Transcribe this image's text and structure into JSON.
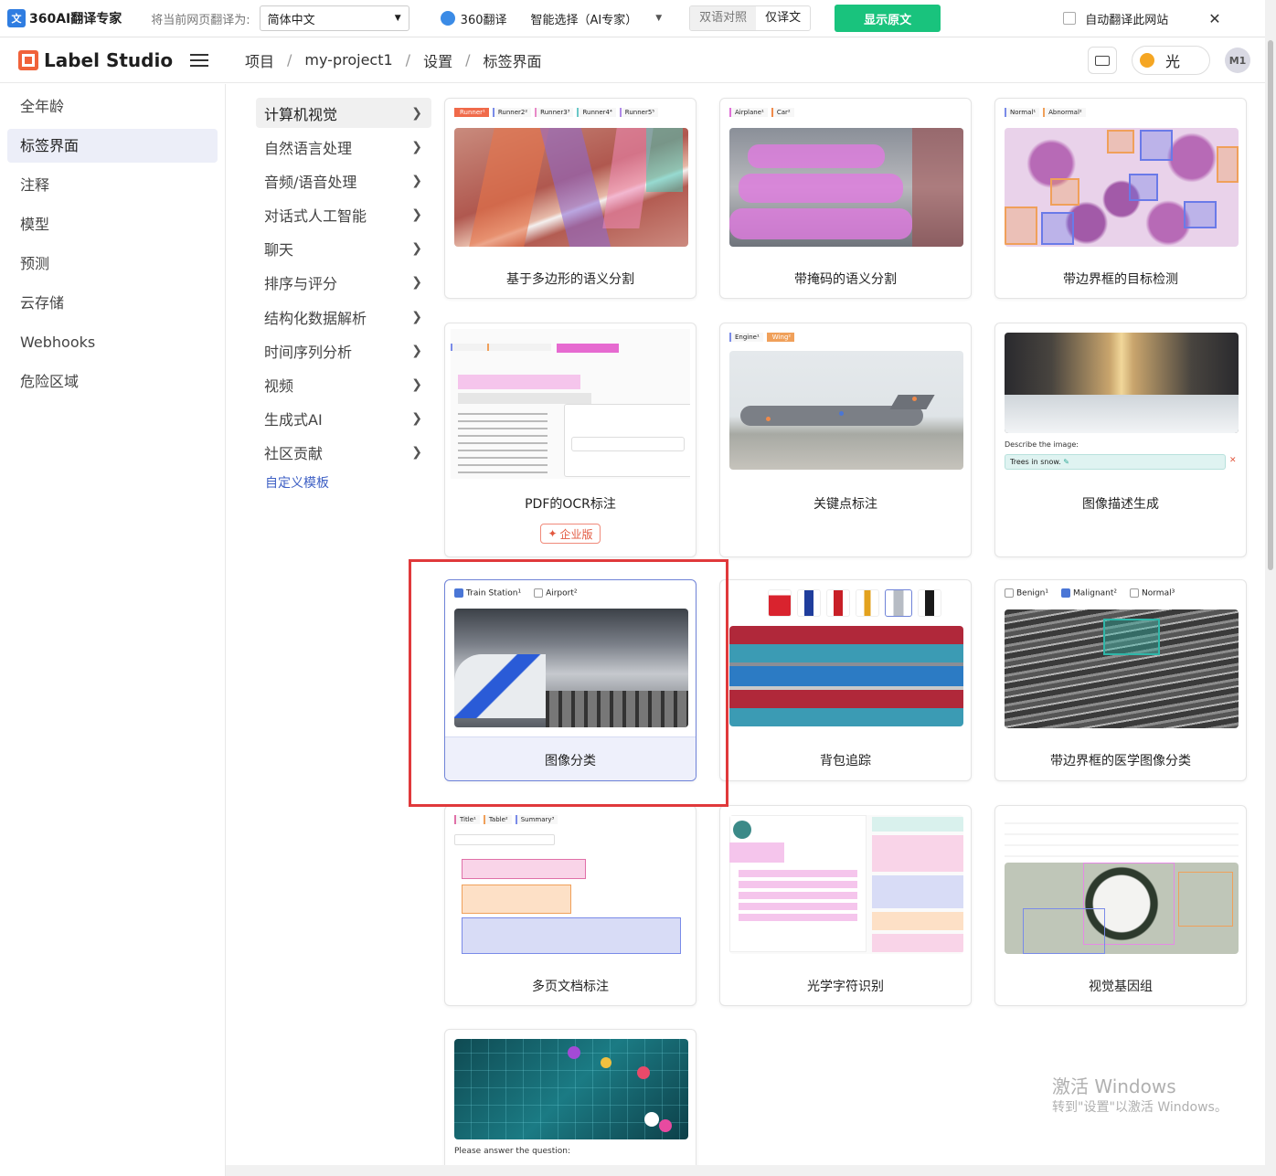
{
  "translate_bar": {
    "brand": "360AI翻译专家",
    "hint": "将当前网页翻译为:",
    "language": "简体中文",
    "engine": "360翻译",
    "mode": "智能选择（AI专家）",
    "bilingual": "双语对照",
    "translation_only": "仅译文",
    "show_original": "显示原文",
    "auto_translate": "自动翻译此网站"
  },
  "header": {
    "brand": "Label Studio",
    "breadcrumbs": [
      "项目",
      "my-project1",
      "设置",
      "标签界面"
    ],
    "theme_label": "光",
    "avatar": "M1"
  },
  "left_nav": [
    "全年龄",
    "标签界面",
    "注释",
    "模型",
    "预测",
    "云存储",
    "Webhooks",
    "危险区域"
  ],
  "categories": [
    "计算机视觉",
    "自然语言处理",
    "音频/语音处理",
    "对话式人工智能",
    "聊天",
    "排序与评分",
    "结构化数据解析",
    "时间序列分析",
    "视频",
    "生成式AI",
    "社区贡献"
  ],
  "custom_template": "自定义模板",
  "cards": [
    {
      "title": "基于多边形的语义分割",
      "tags": [
        "Runner¹",
        "Runner2²",
        "Runner3³",
        "Runner4⁴",
        "Runner5⁵"
      ]
    },
    {
      "title": "带掩码的语义分割",
      "tags": [
        "Airplane¹",
        "Car²"
      ]
    },
    {
      "title": "带边界框的目标检测",
      "tags": [
        "Normal¹",
        "Abnormal²"
      ]
    },
    {
      "title": "PDF的OCR标注",
      "badge": "企业版"
    },
    {
      "title": "关键点标注",
      "tags": [
        "Engine¹",
        "Wing²"
      ]
    },
    {
      "title": "图像描述生成",
      "caption_label": "Describe the image:",
      "caption_value": "Trees in snow."
    },
    {
      "title": "图像分类",
      "classes": [
        "Train Station¹",
        "Airport²"
      ]
    },
    {
      "title": "背包追踪"
    },
    {
      "title": "带边界框的医学图像分类",
      "classes": [
        "Benign¹",
        "Malignant²",
        "Normal³"
      ]
    },
    {
      "title": "多页文档标注",
      "tags": [
        "Title¹",
        "Table²",
        "Summary³"
      ]
    },
    {
      "title": "光学字符识别"
    },
    {
      "title": "视觉基因组"
    },
    {
      "title": "",
      "question": "Please answer the question:"
    }
  ],
  "watermark": {
    "line1": "激活 Windows",
    "line2": "转到\"设置\"以激活 Windows。"
  },
  "colors": {
    "accent": "#6f83d8",
    "highlight": "#e0393b",
    "show_button": "#19c37d",
    "brand": "#f0623a"
  }
}
